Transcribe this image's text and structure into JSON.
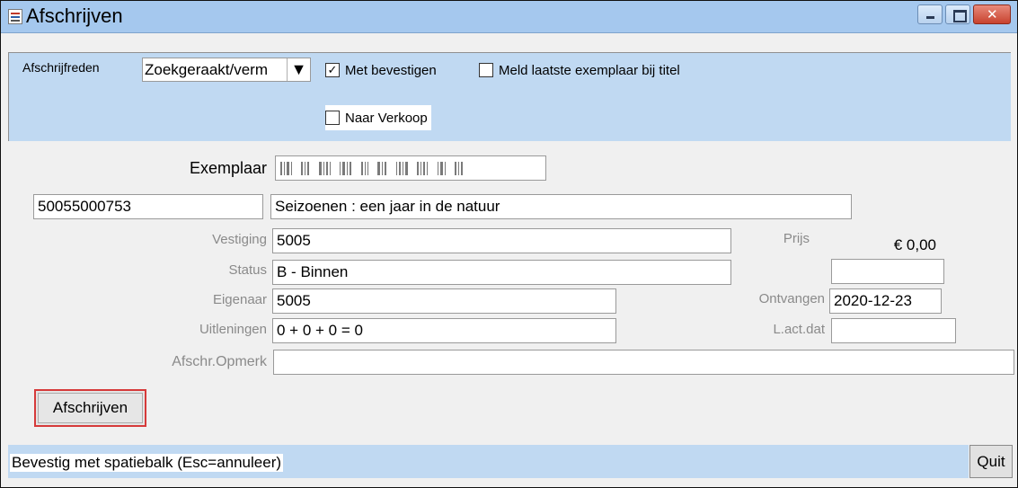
{
  "window": {
    "title": "Afschrijven",
    "icon": "java-cup-icon"
  },
  "options": {
    "reden_label": "Afschrijfreden",
    "reden_value": "Zoekgeraakt/verm",
    "met_bevestigen_label": "Met bevestigen",
    "met_bevestigen_checked": true,
    "meld_laatste_label": "Meld laatste exemplaar bij titel",
    "meld_laatste_checked": false,
    "naar_verkoop_label": "Naar Verkoop",
    "naar_verkoop_checked": false
  },
  "form": {
    "exemplaar_label": "Exemplaar",
    "barcode_value": "50055000753",
    "title_value": "Seizoenen : een jaar in de natuur",
    "vestiging_label": "Vestiging",
    "vestiging_value": "5005",
    "prijs_label": "Prijs",
    "prijs_value": "€ 0,00",
    "status_label": "Status",
    "status_value": "B - Binnen",
    "status_extra_value": "",
    "eigenaar_label": "Eigenaar",
    "eigenaar_value": "5005",
    "ontvangen_label": "Ontvangen",
    "ontvangen_value": "2020-12-23",
    "uitleningen_label": "Uitleningen",
    "uitleningen_value": "0 + 0 + 0 = 0",
    "lactdat_label": "L.act.dat",
    "lactdat_value": "",
    "opmerk_label": "Afschr.Opmerk",
    "opmerk_value": ""
  },
  "buttons": {
    "afschrijven_label": "Afschrijven",
    "quit_label": "Quit"
  },
  "status": {
    "text": "Bevestig met spatiebalk (Esc=annuleer)"
  },
  "colors": {
    "panel_blue": "#c0d9f2",
    "titlebar_blue": "#a5c8ee",
    "focus_red": "#d63a3a"
  }
}
